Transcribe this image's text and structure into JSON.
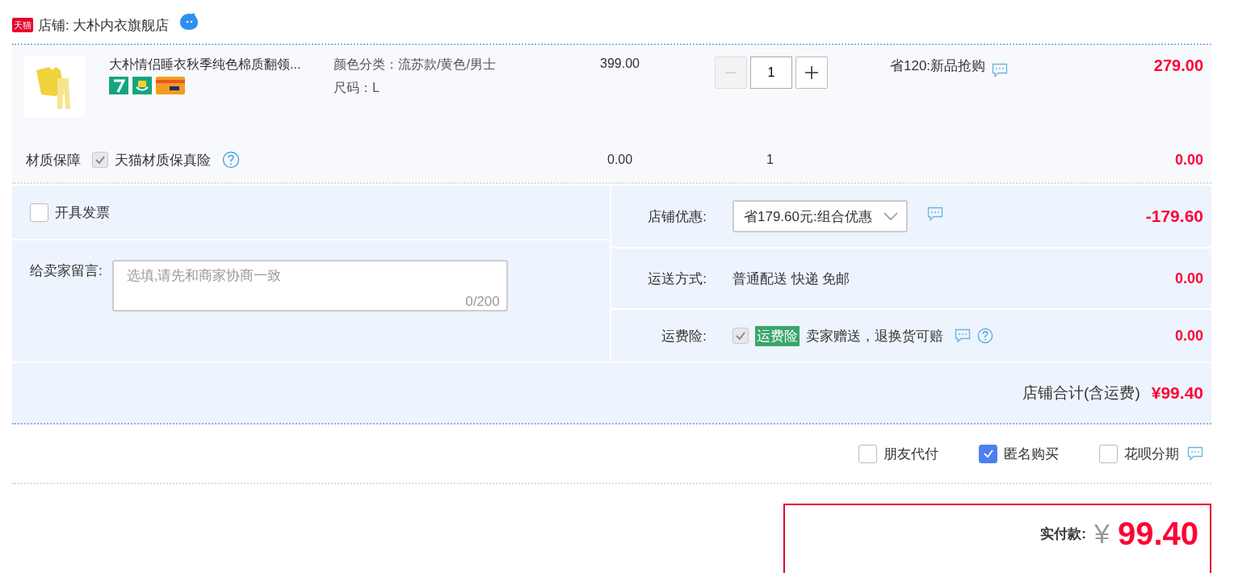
{
  "store": {
    "badge": "天猫",
    "name": "店铺: 大朴内衣旗舰店"
  },
  "item": {
    "title": "大朴情侣睡衣秋季纯色棉质翻领...",
    "sku": [
      "颜色分类：流苏款/黄色/男士",
      "尺码：L"
    ],
    "price": "399.00",
    "quantity": "1",
    "minus_disabled": true,
    "promo": "省120:新品抢购",
    "subtotal": "279.00"
  },
  "insurance": {
    "label": "材质保障",
    "option": "天猫材质保真险",
    "checked": true,
    "disabled": true,
    "price": "0.00",
    "quantity": "1",
    "subtotal": "0.00"
  },
  "invoice": {
    "label": "开具发票",
    "checked": false
  },
  "message": {
    "label": "给卖家留言:",
    "placeholder": "选填,请先和商家协商一致",
    "counter": "0/200"
  },
  "discount": {
    "label": "店铺优惠:",
    "value": "省179.60元:组合优惠",
    "amount": "-179.60"
  },
  "shipping": {
    "label": "运送方式:",
    "value": "普通配送 快递 免邮",
    "amount": "0.00"
  },
  "freight_insurance": {
    "label": "运费险:",
    "checked": true,
    "disabled": true,
    "tag": "运费险",
    "text": "卖家赠送，退换货可赔",
    "amount": "0.00"
  },
  "store_total": {
    "label": "店铺合计(含运费)",
    "amount": "¥99.40"
  },
  "options": [
    {
      "label": "朋友代付",
      "checked": false,
      "info": false
    },
    {
      "label": "匿名购买",
      "checked": true,
      "info": false
    },
    {
      "label": "花呗分期",
      "checked": false,
      "info": true
    }
  ],
  "payment": {
    "label": "实付款:",
    "currency": "¥",
    "amount": "99.40"
  }
}
